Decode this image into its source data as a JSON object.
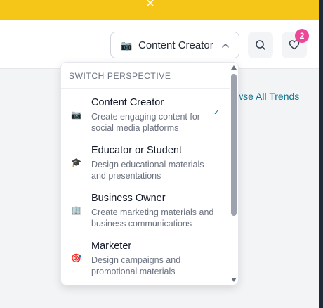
{
  "banner": {
    "close_glyph": "✕",
    "color": "#f5c518"
  },
  "header": {
    "perspective": {
      "emoji": "📷",
      "label": "Content Creator",
      "chevron": "chevron-up-icon"
    },
    "search_icon": "search-icon",
    "favorites": {
      "icon": "heart-icon",
      "badge_count": "2",
      "badge_color": "#ec4899"
    }
  },
  "page": {
    "browse_link": "wse All Trends"
  },
  "dropdown": {
    "heading": "SWITCH PERSPECTIVE",
    "options": [
      {
        "emoji": "📷",
        "title": "Content Creator",
        "description": "Create engaging content for social media platforms",
        "selected": true,
        "check": "✓"
      },
      {
        "emoji": "🎓",
        "title": "Educator or Student",
        "description": "Design educational materials and presentations",
        "selected": false
      },
      {
        "emoji": "🏢",
        "title": "Business Owner",
        "description": "Create marketing materials and business communications",
        "selected": false
      },
      {
        "emoji": "🎯",
        "title": "Marketer",
        "description": "Design campaigns and promotional materials",
        "selected": false
      }
    ]
  },
  "colors": {
    "accent": "#0e7490",
    "text": "#111827",
    "muted": "#6b7280"
  }
}
